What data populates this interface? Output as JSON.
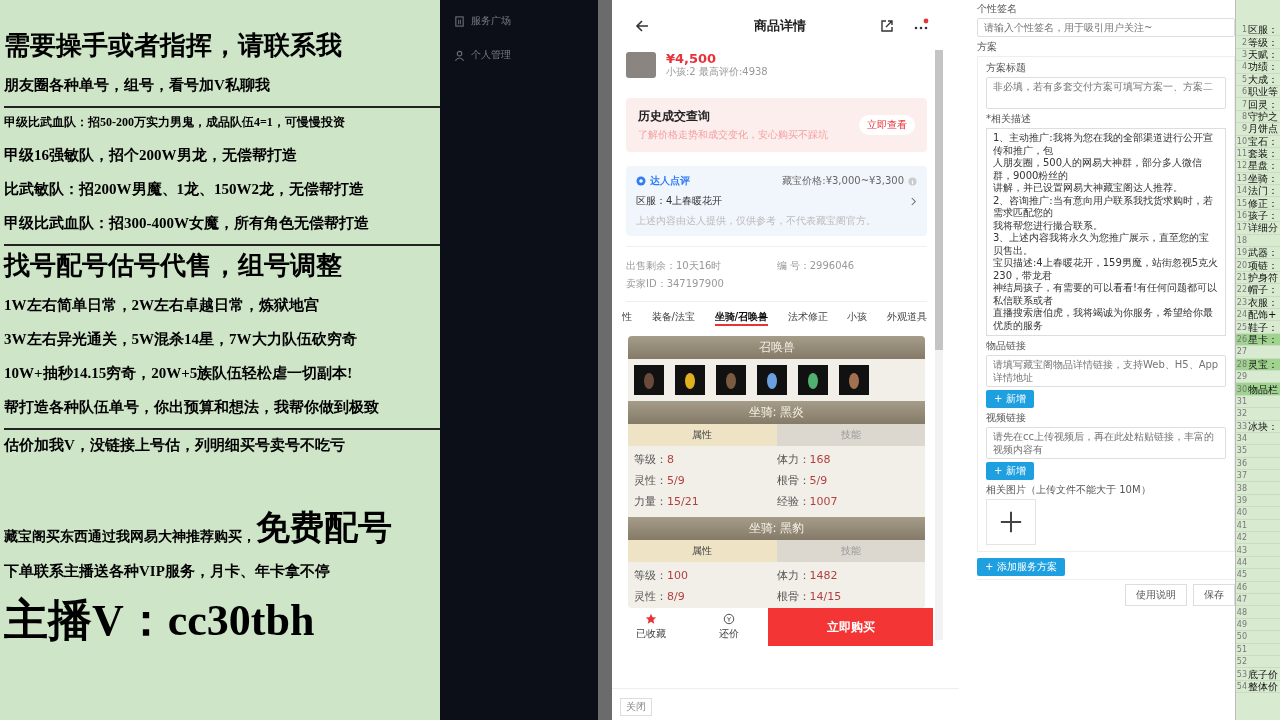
{
  "promo_panel": {
    "sections": [
      {
        "items": [
          {
            "kind": "heading",
            "text": "需要操手或者指挥，请联系我"
          },
          {
            "kind": "line",
            "text": "朋友圈各种单号，组号，看号加V私聊我"
          }
        ]
      },
      {
        "items": [
          {
            "kind": "small",
            "text": "甲级比武血队：招50-200万实力男鬼，成品队伍4=1，可慢慢投资"
          },
          {
            "kind": "line",
            "text": "甲级16强敏队，招个200W男龙，无偿帮打造"
          },
          {
            "kind": "line",
            "text": "比武敏队：招200W男魔、1龙、150W2龙，无偿帮打造"
          },
          {
            "kind": "line",
            "text": "甲级比武血队：招300-400W女魔，所有角色无偿帮打造"
          }
        ]
      },
      {
        "items": [
          {
            "kind": "heading",
            "text": "找号配号估号代售，组号调整"
          },
          {
            "kind": "line",
            "text": "1W左右简单日常，2W左右卓越日常，炼狱地宫"
          },
          {
            "kind": "line",
            "text": "3W左右异光通关，5W混杀14星，7W大力队伍砍穷奇"
          },
          {
            "kind": "line",
            "text": "10W+抽秒14.15穷奇，20W+5族队伍轻松虐一切副本!"
          },
          {
            "kind": "line",
            "text": "帮打造各种队伍单号，你出预算和想法，我帮你做到极致"
          }
        ]
      },
      {
        "items": [
          {
            "kind": "line",
            "text": "估价加我V，没链接上号估，列明细买号卖号不吃亏"
          },
          {
            "kind": "mixed",
            "text": "藏宝阁买东西通过我网易大神推荐购买，",
            "big": "免费配号"
          },
          {
            "kind": "line",
            "text": "下单联系主播送各种VIP服务，月卡、年卡拿不停"
          },
          {
            "kind": "contact",
            "text": "主播V：cc30tbh"
          }
        ]
      }
    ]
  },
  "sidebar": {
    "items": [
      {
        "kind": "building",
        "label": "服务广场"
      },
      {
        "kind": "person",
        "label": "个人管理"
      }
    ]
  },
  "phone": {
    "title": "商品详情",
    "price": "¥4,500",
    "subtitle": "小孩:2 最高评价:4938",
    "history": {
      "title": "历史成交查询",
      "hint": "了解价格走势和成交变化，安心购买不踩坑",
      "button": "立即查看"
    },
    "review": {
      "title": "达人点评",
      "price": "藏宝价格:¥3,000~¥3,300",
      "server": "区服：4上春暖花开",
      "note": "上述内容由达人提供，仅供参考，不代表藏宝阁官方。"
    },
    "info": [
      "出售剩余：10天16时",
      "编 号：2996046",
      "卖家ID：347197900"
    ],
    "tabs": [
      {
        "label": "性",
        "selected": false
      },
      {
        "label": "装备/法宝",
        "selected": false
      },
      {
        "label": "坐骑/召唤兽",
        "selected": true
      },
      {
        "label": "法术修正",
        "selected": false
      },
      {
        "label": "小孩",
        "selected": false
      },
      {
        "label": "外观道具",
        "selected": false
      }
    ],
    "summon_title": "召唤兽",
    "mounts": [
      {
        "title": "坐骑: 黑炎",
        "subtabs": [
          {
            "label": "属性",
            "selected": true
          },
          {
            "label": "技能",
            "selected": false
          }
        ],
        "stats": [
          [
            "等级：",
            "8"
          ],
          [
            "体力：",
            "168"
          ],
          [
            "灵性：",
            "5/9"
          ],
          [
            "根骨：",
            "5/9"
          ],
          [
            "力量：",
            "15/21"
          ],
          [
            "经验：",
            "1007"
          ]
        ]
      },
      {
        "title": "坐骑: 黑豹",
        "subtabs": [
          {
            "label": "属性",
            "selected": true
          },
          {
            "label": "技能",
            "selected": false
          }
        ],
        "stats": [
          [
            "等级：",
            "100"
          ],
          [
            "体力：",
            "1482"
          ],
          [
            "灵性：",
            "8/9"
          ],
          [
            "根骨：",
            "14/15"
          ]
        ]
      }
    ],
    "bottom": {
      "favorite": "已收藏",
      "bargain": "还价",
      "buy": "立即购买"
    },
    "close": "关闭"
  },
  "form": {
    "signature_label": "个性签名",
    "signature_placeholder": "请输入个性签名，用于吸引用户关注~",
    "plan_label": "方案",
    "title_label": "方案标题",
    "title_placeholder": "非必填，若有多套交付方案可填写方案一、方案二",
    "desc_label": "*相关描述",
    "desc_lines": [
      "1、主动推广:我将为您在我的全部渠道进行公开宣传和推广，包",
      "人朋友圈，500人的网易大神群，部分多人微信群，9000粉丝的",
      "讲解，并已设置网易大神藏宝阁达人推荐。",
      "2、咨询推广:当有意向用户联系我找货求购时，若需求匹配您的",
      "我将帮您进行撮合联系。",
      "3、上述内容我将永久为您推广展示，直至您的宝贝售出。",
      "宝贝描述:4上春暖花开，159男魔，站街忽视5克火230，带龙君",
      "神结局孩子，有需要的可以看看!有任何问题都可以私信联系或者",
      "直播搜索唐伯虎，我将竭诚为你服务，希望给你最优质的服务"
    ],
    "link_label": "物品链接",
    "link_placeholder": "请填写藏宝阁物品详情链接，支持Web、H5、App详情地址",
    "add": "+ 新增",
    "video_label": "视频链接",
    "video_placeholder": "请先在cc上传视频后，再在此处粘贴链接，丰富的视频内容有",
    "add2": "+ 新增",
    "image_label": "相关图片（上传文件不能大于 10M）",
    "add_plan": "+ 添加服务方案",
    "help": "使用说明",
    "save": "保存"
  },
  "sheet": {
    "rows": [
      {
        "num": "1",
        "label": "区服：",
        "highlight": false
      },
      {
        "num": "2",
        "label": "等级：",
        "highlight": false
      },
      {
        "num": "3",
        "label": "天赋：",
        "highlight": false
      },
      {
        "num": "4",
        "label": "功绩：",
        "highlight": false
      },
      {
        "num": "5",
        "label": "大成：",
        "highlight": false
      },
      {
        "num": "6",
        "label": "职业等",
        "highlight": false
      },
      {
        "num": "7",
        "label": "回灵：",
        "highlight": false
      },
      {
        "num": "8",
        "label": "守护之",
        "highlight": false
      },
      {
        "num": "9",
        "label": "月饼点",
        "highlight": false
      },
      {
        "num": "10",
        "label": "宝石：",
        "highlight": false
      },
      {
        "num": "11",
        "label": "套装：",
        "highlight": false
      },
      {
        "num": "12",
        "label": "星盘：",
        "highlight": false
      },
      {
        "num": "13",
        "label": "坐骑：",
        "highlight": false
      },
      {
        "num": "14",
        "label": "法门：",
        "highlight": false
      },
      {
        "num": "15",
        "label": "修正：",
        "highlight": false
      },
      {
        "num": "16",
        "label": "孩子：",
        "highlight": false
      },
      {
        "num": "17",
        "label": "详细分",
        "highlight": false
      },
      {
        "num": "18",
        "highlight": false
      },
      {
        "num": "19",
        "label": "武器：",
        "highlight": false
      },
      {
        "num": "20",
        "label": "项链：",
        "highlight": false
      },
      {
        "num": "21",
        "label": "护身符",
        "highlight": false
      },
      {
        "num": "22",
        "label": "帽子：",
        "highlight": false
      },
      {
        "num": "23",
        "label": "衣服：",
        "highlight": false
      },
      {
        "num": "24",
        "label": "配饰+",
        "highlight": false
      },
      {
        "num": "25",
        "label": "鞋子：",
        "highlight": false
      },
      {
        "num": "26",
        "label": "星卡：",
        "highlight": true
      },
      {
        "num": "27",
        "highlight": false
      },
      {
        "num": "28",
        "label": "灵宝：",
        "highlight": true
      },
      {
        "num": "29",
        "highlight": false
      },
      {
        "num": "30",
        "label": "物品栏",
        "highlight": true
      },
      {
        "num": "31",
        "highlight": false
      },
      {
        "num": "32",
        "highlight": false
      },
      {
        "num": "33",
        "label": "冰块：",
        "highlight": false
      },
      {
        "num": "34",
        "highlight": false
      },
      {
        "num": "35",
        "highlight": false
      },
      {
        "num": "36",
        "highlight": false
      },
      {
        "num": "37",
        "highlight": false
      },
      {
        "num": "38",
        "highlight": false
      },
      {
        "num": "39",
        "highlight": false
      },
      {
        "num": "40",
        "highlight": false
      },
      {
        "num": "41",
        "highlight": false
      },
      {
        "num": "42",
        "highlight": false
      },
      {
        "num": "43",
        "highlight": false
      },
      {
        "num": "44",
        "highlight": false
      },
      {
        "num": "45",
        "highlight": false
      },
      {
        "num": "46",
        "highlight": false
      },
      {
        "num": "47",
        "highlight": false
      },
      {
        "num": "48",
        "highlight": false
      },
      {
        "num": "49",
        "highlight": false
      },
      {
        "num": "50",
        "highlight": false
      },
      {
        "num": "51",
        "highlight": false
      },
      {
        "num": "52",
        "highlight": false
      },
      {
        "num": "53",
        "label": "底子价",
        "highlight": false
      },
      {
        "num": "54",
        "label": "整体价",
        "highlight": false
      }
    ]
  }
}
